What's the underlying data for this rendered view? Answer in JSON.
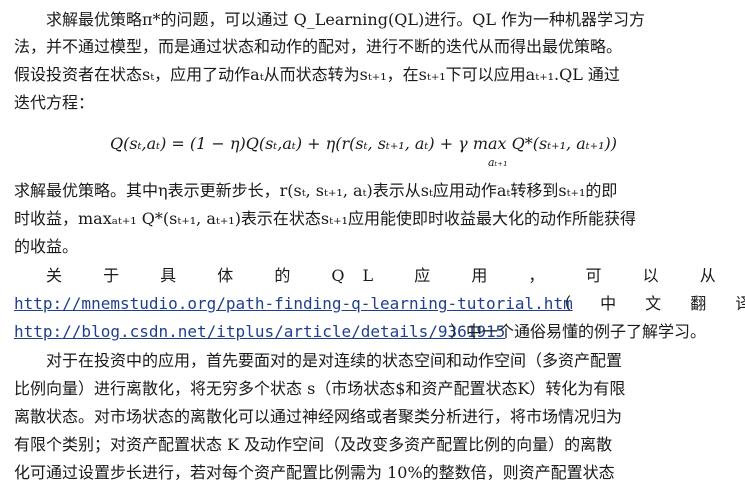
{
  "doc": {
    "lines": [
      "求解最优策略π*的问题，可以通过 Q_Learning(QL)进行。QL 作为一种机器学习方",
      "法，并不通过模型，而是通过状态和动作的配对，进行不断的迭代从而得出最优策略。",
      "假设投资者在状态sₜ，应用了动作aₜ从而状态转为sₜ₊₁，在sₜ₊₁下可以应用aₜ₊₁.QL 通过",
      "迭代方程：",
      "求解最优策略。其中η表示更新步长，r(sₜ, sₜ₊₁, aₜ)表示从sₜ应用动作aₜ转移到sₜ₊₁的即",
      "时收益，maxₐₜ₊₁ Q*(sₜ₊₁, aₜ₊₁)表示在状态sₜ₊₁应用能使即时收益最大化的动作所能获得",
      "的收益。",
      "关 于 具 体 的  QL  应 用 ， 可 以 从",
      "（ 中 文 翻 译",
      "）中一个通俗易懂的例子了解学习。",
      "对于在投资中的应用，首先要面对的是对连续的状态空间和动作空间（多资产配置",
      "比例向量）进行离散化，将无穷多个状态 s（市场状态$和资产配置状态K）转化为有限",
      "离散状态。对市场状态的离散化可以通过神经网络或者聚类分析进行，将市场情况归为",
      "有限个类别；对资产配置状态 K 及动作空间（及改变多资产配置比例的向量）的离散",
      "化可通过设置步长进行，若对每个资产配置比例需为 10%的整数倍，则资产配置状态"
    ],
    "equation": "Q(sₜ,aₜ) = (1 − η)Q(sₜ,aₜ) + η(r(sₜ, sₜ₊₁, aₜ) + γ max Q*(sₜ₊₁, aₜ₊₁))",
    "equation_sub": "aₜ₊₁",
    "links": [
      "http://mnemstudio.org/path-finding-q-learning-tutorial.htm",
      "http://blog.csdn.net/itplus/article/details/9361915"
    ]
  },
  "colors": {
    "text": "#1a1a1a",
    "link": "#1f3f8f"
  }
}
